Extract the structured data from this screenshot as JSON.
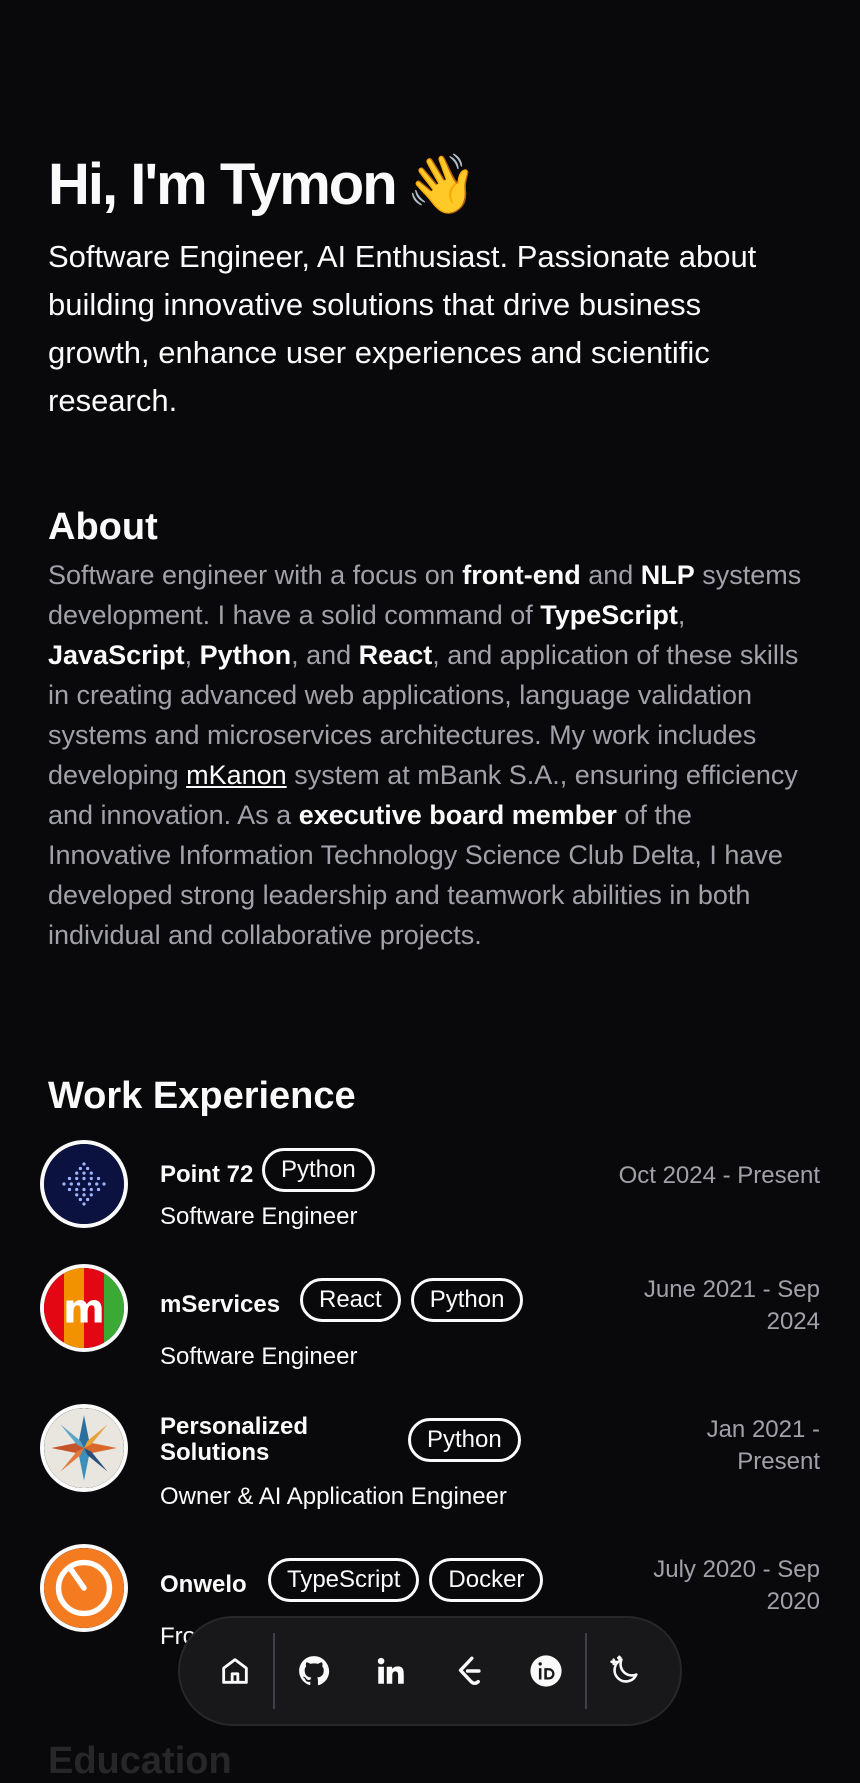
{
  "hero": {
    "title": "Hi, I'm Tymon",
    "emoji": "👋",
    "subtitle": "Software Engineer, AI Enthusiast. Passionate about building innovative solutions that drive business growth, enhance user experiences and scientific research."
  },
  "about": {
    "title": "About",
    "segments": [
      "Software engineer with a focus on ",
      "front-end",
      " and ",
      "NLP",
      " systems development. I have a solid command of ",
      "TypeScript",
      ", ",
      "JavaScript",
      ", ",
      "Python",
      ", and ",
      "React",
      ", and application of these skills in creating advanced web applications, language validation systems and microservices architectures. My work includes developing ",
      "mKanon",
      " system at mBank S.A., ensuring efficiency and innovation. As a ",
      "executive board member",
      " of the Innovative Information Technology Science Club Delta, I have developed strong leadership and teamwork abilities in both individual and collaborative projects."
    ]
  },
  "work": {
    "title": "Work Experience",
    "jobs": [
      {
        "company": "Point 72",
        "tags": [
          "Python"
        ],
        "role": "Software Engineer",
        "date": "Oct 2024 - Present"
      },
      {
        "company": "mServices",
        "tags": [
          "React",
          "Python"
        ],
        "role": "Software Engineer",
        "date": "June 2021 - Sep 2024"
      },
      {
        "company": "Personalized Solutions",
        "tags": [
          "Python"
        ],
        "role": "Owner & AI Application Engineer",
        "date": "Jan 2021 - Present"
      },
      {
        "company": "Onwelo",
        "tags": [
          "TypeScript",
          "Docker"
        ],
        "role": "Fro",
        "date": "July 2020 - Sep 2020"
      }
    ]
  },
  "dock": {
    "icons": [
      "home-icon",
      "github-icon",
      "linkedin-icon",
      "leetcode-icon",
      "orcid-icon",
      "theme-toggle-icon"
    ]
  },
  "colors": {
    "background": "#09090b",
    "text": "#fafafa",
    "muted": "#a1a1aa",
    "mservices_red": "#e30613",
    "onwelo_orange": "#f47b20"
  },
  "education": {
    "title": "Education"
  }
}
